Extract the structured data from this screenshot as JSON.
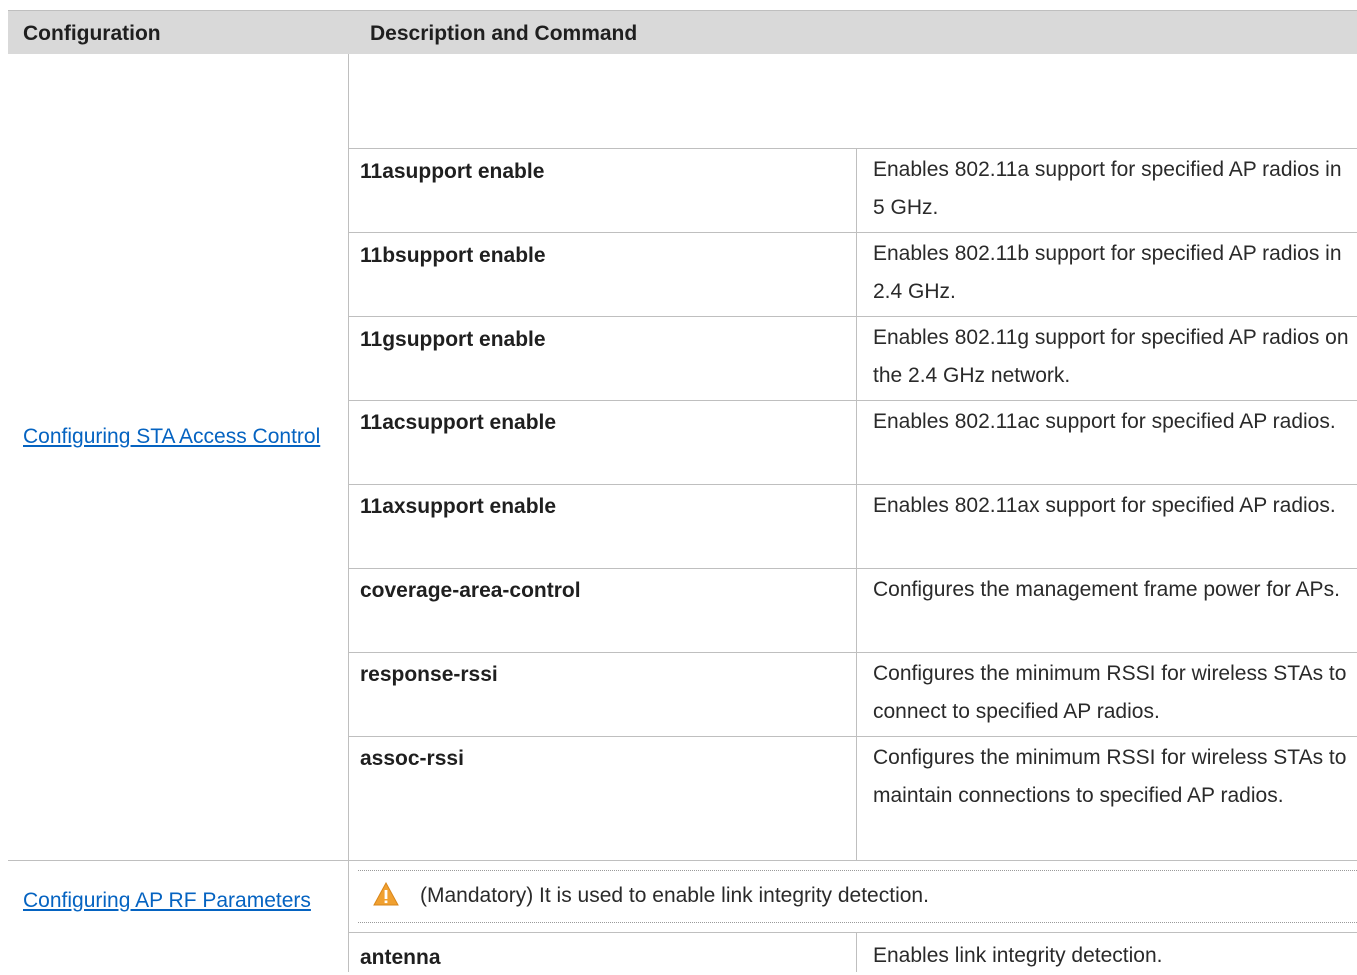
{
  "table": {
    "headers": {
      "configuration": "Configuration",
      "description": "Description and Command"
    },
    "sections": [
      {
        "link": "Configuring STA Access Control",
        "rows": [
          {
            "command": "11asupport enable",
            "description": "Enables 802.11a support for specified AP radios in 5 GHz."
          },
          {
            "command": "11bsupport enable",
            "description": "Enables 802.11b support for specified AP radios in 2.4 GHz."
          },
          {
            "command": "11gsupport enable",
            "description": "Enables 802.11g support for specified AP radios on the 2.4 GHz network."
          },
          {
            "command": "11acsupport enable",
            "description": "Enables 802.11ac support for specified AP radios."
          },
          {
            "command": "11axsupport enable",
            "description": "Enables 802.11ax support for specified AP radios."
          },
          {
            "command": "coverage-area-control",
            "description": "Configures the management frame power for APs."
          },
          {
            "command": "response-rssi",
            "description": "Configures the minimum RSSI for wireless STAs to connect to specified AP radios."
          },
          {
            "command": "assoc-rssi",
            "description": "Configures the minimum RSSI for wireless STAs to maintain connections to specified AP radios."
          }
        ]
      },
      {
        "link": "Configuring AP RF Parameters",
        "note": "(Mandatory) It is used to enable link integrity detection.",
        "rows": [
          {
            "command": "antenna",
            "description": "Enables link integrity detection."
          }
        ]
      }
    ]
  },
  "colors": {
    "header_bg": "#d9d9d9",
    "link": "#0563c1",
    "warning": "#f0a030"
  }
}
